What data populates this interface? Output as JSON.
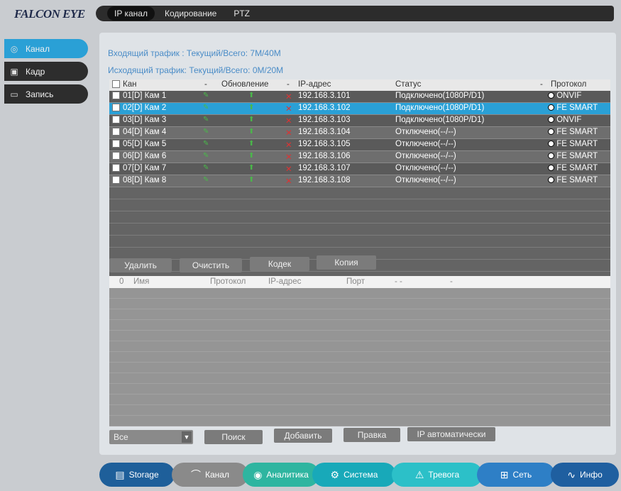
{
  "brand": "FALCON EYE",
  "top_tabs": [
    "IP канал",
    "Кодирование",
    "PTZ"
  ],
  "sidebar": [
    {
      "label": "Канал",
      "icon": "camera-icon",
      "active": true
    },
    {
      "label": "Кадр",
      "icon": "image-icon",
      "active": false
    },
    {
      "label": "Запись",
      "icon": "record-icon",
      "active": false
    }
  ],
  "traffic": {
    "incoming": "Входящий трафик : Текущий/Всего: 7M/40M",
    "outgoing": "Исходящий трафик: Текущий/Всего: 0M/20M"
  },
  "channel_table": {
    "headers": {
      "channel": "Кан",
      "dash1": "-",
      "update": "Обновление",
      "dash2": "-",
      "ip": "IP-адрес",
      "status": "Статус",
      "dash3": "-",
      "protocol": "Протокол"
    },
    "rows": [
      {
        "channel": "01[D] Кам 1",
        "ip": "192.168.3.101",
        "status": "Подключено(1080P/D1)",
        "protocol": "ONVIF",
        "selected": false
      },
      {
        "channel": "02[D] Кам 2",
        "ip": "192.168.3.102",
        "status": "Подключено(1080P/D1)",
        "protocol": "FE SMART",
        "selected": true
      },
      {
        "channel": "03[D] Кам 3",
        "ip": "192.168.3.103",
        "status": "Подключено(1080P/D1)",
        "protocol": "ONVIF",
        "selected": false
      },
      {
        "channel": "04[D] Кам 4",
        "ip": "192.168.3.104",
        "status": "Отключено(--/--)",
        "protocol": "FE SMART",
        "selected": false
      },
      {
        "channel": "05[D] Кам 5",
        "ip": "192.168.3.105",
        "status": "Отключено(--/--)",
        "protocol": "FE SMART",
        "selected": false
      },
      {
        "channel": "06[D] Кам 6",
        "ip": "192.168.3.106",
        "status": "Отключено(--/--)",
        "protocol": "FE SMART",
        "selected": false
      },
      {
        "channel": "07[D] Кам 7",
        "ip": "192.168.3.107",
        "status": "Отключено(--/--)",
        "protocol": "FE SMART",
        "selected": false
      },
      {
        "channel": "08[D] Кам 8",
        "ip": "192.168.3.108",
        "status": "Отключено(--/--)",
        "protocol": "FE SMART",
        "selected": false
      }
    ]
  },
  "channel_buttons": {
    "delete": "Удалить",
    "clear": "Очистить",
    "codec": "Кодек",
    "copy": "Копия"
  },
  "device_table": {
    "headers": {
      "num": "0",
      "name": "Имя",
      "protocol": "Протокол",
      "ip": "IP-адрес",
      "port": "Порт",
      "dashes": "- -",
      "dash": "-"
    }
  },
  "device_filter": {
    "selected": "Все"
  },
  "device_buttons": {
    "search": "Поиск",
    "add": "Добавить",
    "edit": "Правка",
    "auto_ip": "IP автоматически"
  },
  "bottom_nav": [
    {
      "label": "Storage",
      "icon": "save-icon"
    },
    {
      "label": "Канал",
      "icon": "camera-icon"
    },
    {
      "label": "Аналитика",
      "icon": "analytics-icon"
    },
    {
      "label": "Система",
      "icon": "gear-icon"
    },
    {
      "label": "Тревога",
      "icon": "alarm-icon"
    },
    {
      "label": "Сеть",
      "icon": "network-icon"
    },
    {
      "label": "Инфо",
      "icon": "pulse-icon"
    }
  ],
  "colors": {
    "accent": "#2aa0d6",
    "teal": "#18a9b9",
    "navy": "#1e5f9a"
  }
}
